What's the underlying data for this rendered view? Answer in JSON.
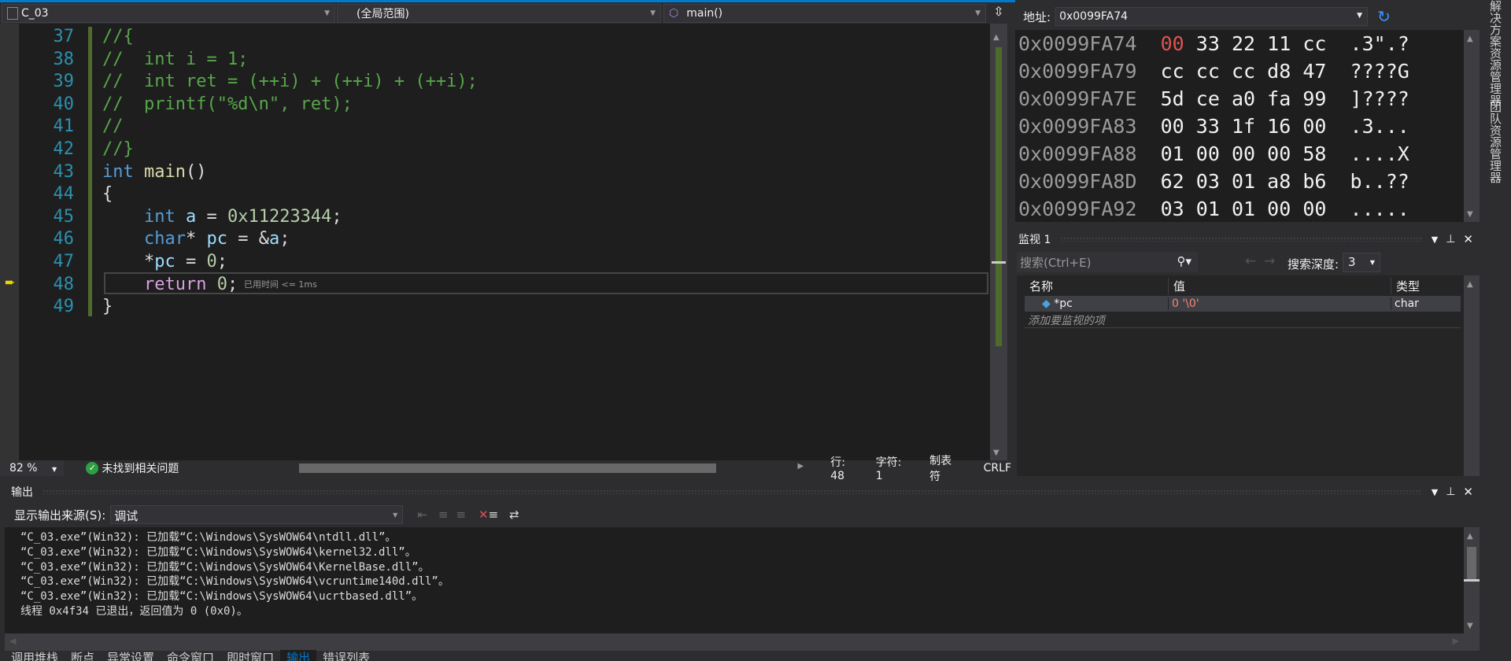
{
  "navbar": {
    "project": "C_03",
    "scope": "(全局范围)",
    "function": "main()"
  },
  "editor": {
    "lines": [
      {
        "n": "37",
        "parts": [
          [
            "cm",
            "//{"
          ]
        ]
      },
      {
        "n": "38",
        "parts": [
          [
            "cm",
            "//  int i = 1;"
          ]
        ]
      },
      {
        "n": "39",
        "parts": [
          [
            "cm",
            "//  int ret = (++i) + (++i) + (++i);"
          ]
        ]
      },
      {
        "n": "40",
        "parts": [
          [
            "cm",
            "//  printf(\"%d\\n\", ret);"
          ]
        ]
      },
      {
        "n": "41",
        "parts": [
          [
            "cm",
            "//"
          ]
        ]
      },
      {
        "n": "42",
        "parts": [
          [
            "cm",
            "//}"
          ]
        ]
      },
      {
        "n": "43",
        "parts": [
          [
            "kw",
            "int "
          ],
          [
            "fn",
            "main"
          ],
          [
            "",
            "()"
          ]
        ]
      },
      {
        "n": "44",
        "parts": [
          [
            "",
            "{"
          ]
        ]
      },
      {
        "n": "45",
        "parts": [
          [
            "",
            "    "
          ],
          [
            "kw",
            "int "
          ],
          [
            "var",
            "a"
          ],
          [
            "",
            " = "
          ],
          [
            "nm",
            "0x11223344"
          ],
          [
            "",
            ";"
          ]
        ]
      },
      {
        "n": "46",
        "parts": [
          [
            "",
            "    "
          ],
          [
            "kw",
            "char"
          ],
          [
            "",
            "* "
          ],
          [
            "var",
            "pc"
          ],
          [
            "",
            " = &"
          ],
          [
            "var",
            "a"
          ],
          [
            "",
            ";"
          ]
        ]
      },
      {
        "n": "47",
        "parts": [
          [
            "",
            "    *"
          ],
          [
            "var",
            "pc"
          ],
          [
            "",
            " = "
          ],
          [
            "nm",
            "0"
          ],
          [
            "",
            ";"
          ]
        ]
      },
      {
        "n": "48",
        "parts": [
          [
            "",
            "    "
          ],
          [
            "ret",
            "return "
          ],
          [
            "nm",
            "0"
          ],
          [
            "",
            ";"
          ]
        ]
      },
      {
        "n": "49",
        "parts": [
          [
            "",
            "}"
          ]
        ]
      }
    ],
    "current_line": "48",
    "perf_tip": "已用时间 <= 1ms"
  },
  "status": {
    "zoom": "82 %",
    "issues": "未找到相关问题",
    "line": "行: 48",
    "char": "字符: 1",
    "indent": "制表符",
    "eol": "CRLF"
  },
  "memory": {
    "address_label": "地址:",
    "address": "0x0099FA74",
    "rows": [
      {
        "addr": "0x0099FA74",
        "bytes": [
          "00",
          "33",
          "22",
          "11",
          "cc"
        ],
        "ascii": ".3\".?",
        "changed": [
          0
        ]
      },
      {
        "addr": "0x0099FA79",
        "bytes": [
          "cc",
          "cc",
          "cc",
          "d8",
          "47"
        ],
        "ascii": "????G",
        "changed": []
      },
      {
        "addr": "0x0099FA7E",
        "bytes": [
          "5d",
          "ce",
          "a0",
          "fa",
          "99"
        ],
        "ascii": "]????",
        "changed": []
      },
      {
        "addr": "0x0099FA83",
        "bytes": [
          "00",
          "33",
          "1f",
          "16",
          "00"
        ],
        "ascii": ".3...",
        "changed": []
      },
      {
        "addr": "0x0099FA88",
        "bytes": [
          "01",
          "00",
          "00",
          "00",
          "58"
        ],
        "ascii": "....X",
        "changed": []
      },
      {
        "addr": "0x0099FA8D",
        "bytes": [
          "62",
          "03",
          "01",
          "a8",
          "b6"
        ],
        "ascii": "b..??",
        "changed": []
      },
      {
        "addr": "0x0099FA92",
        "bytes": [
          "03",
          "01",
          "01",
          "00",
          "00"
        ],
        "ascii": ".....",
        "changed": []
      }
    ],
    "changed_color": "#e05252"
  },
  "watch": {
    "title": "监视 1",
    "search_placeholder": "搜索(Ctrl+E)",
    "depth_label": "搜索深度:",
    "depth": "3",
    "columns": [
      "名称",
      "值",
      "类型"
    ],
    "rows": [
      {
        "name": "*pc",
        "value": "0 '\\0'",
        "type": "char"
      }
    ],
    "add_placeholder": "添加要监视的项"
  },
  "output": {
    "title": "输出",
    "source_label": "显示输出来源(S):",
    "source": "调试",
    "lines": [
      "“C_03.exe”(Win32): 已加载“C:\\Windows\\SysWOW64\\ntdll.dll”。",
      "“C_03.exe”(Win32): 已加载“C:\\Windows\\SysWOW64\\kernel32.dll”。",
      "“C_03.exe”(Win32): 已加载“C:\\Windows\\SysWOW64\\KernelBase.dll”。",
      "“C_03.exe”(Win32): 已加载“C:\\Windows\\SysWOW64\\vcruntime140d.dll”。",
      "“C_03.exe”(Win32): 已加载“C:\\Windows\\SysWOW64\\ucrtbased.dll”。",
      "线程 0x4f34 已退出，返回值为 0 (0x0)。"
    ]
  },
  "bottom_tabs": [
    "调用堆栈",
    "断点",
    "异常设置",
    "命令窗口",
    "即时窗口",
    "输出",
    "错误列表"
  ],
  "active_bottom_tab": "输出",
  "side_tabs": [
    "解决方案资源管理器",
    "团队资源管理器"
  ],
  "accent": "#007acc"
}
